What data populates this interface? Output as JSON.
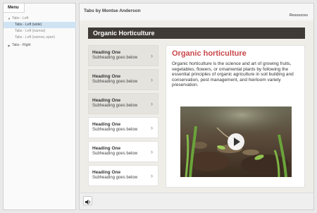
{
  "sidebar": {
    "menu_label": "Menu",
    "items": [
      {
        "label": "Tabs - Left",
        "arrow": "▼"
      },
      {
        "label": "Tabs - Left (wide)"
      },
      {
        "label": "Tabs - Left (narrow)"
      },
      {
        "label": "Tabs - Left (narrow, open)"
      },
      {
        "label": "Tabs - Right",
        "arrow": "▶"
      }
    ]
  },
  "header": {
    "course_title": "Tabs by Montse Anderson",
    "resources_label": "Resources"
  },
  "slide": {
    "banner_title": "Organic Horticulture",
    "tabs": [
      {
        "heading": "Heading One",
        "subheading": "Subheading goes below"
      },
      {
        "heading": "Heading One",
        "subheading": "Subheading goes below"
      },
      {
        "heading": "Heading One",
        "subheading": "Subheading goes below"
      },
      {
        "heading": "Heading One",
        "subheading": "Subheading goes below"
      },
      {
        "heading": "Heading One",
        "subheading": "Subheading goes below"
      },
      {
        "heading": "Heading One",
        "subheading": "Subheading goes below"
      }
    ],
    "panel": {
      "title": "Organic horticulture",
      "body": "Organic horticulture is the science and art of growing fruits, vegetables, flowers, or ornamental plants by following the essential principles of organic agriculture in soil building and conservation, pest management, and heirloom variety preservation."
    }
  },
  "icons": {
    "chevron": "›",
    "play": "play-icon",
    "speaker": "speaker-icon"
  },
  "colors": {
    "accent_title": "#c8474a",
    "banner_bg": "#3f3a35",
    "active_menu_item": "#cfe3f3"
  }
}
